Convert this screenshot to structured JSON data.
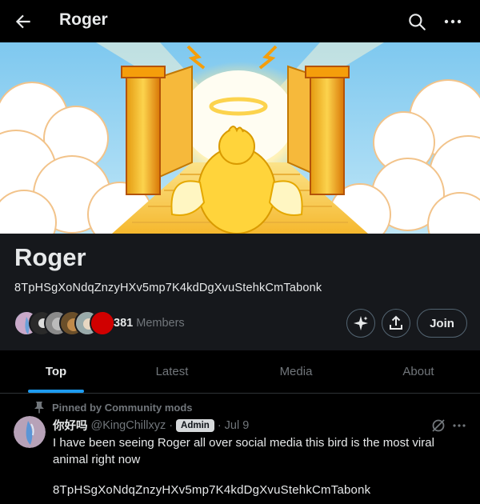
{
  "header": {
    "title": "Roger",
    "back_icon": "arrow-left-icon",
    "search_icon": "search-icon",
    "more_icon": "more-horizontal-icon"
  },
  "community": {
    "name": "Roger",
    "description": "8TpHSgXoNdqZnzyHXv5mp7K4kdDgXvuStehkCmTabonk",
    "member_count": "381",
    "members_label": "Members",
    "join_label": "Join"
  },
  "tabs": [
    {
      "label": "Top",
      "active": true
    },
    {
      "label": "Latest",
      "active": false
    },
    {
      "label": "Media",
      "active": false
    },
    {
      "label": "About",
      "active": false
    }
  ],
  "post": {
    "pinned_label": "Pinned by Community mods",
    "author_name": "你好吗",
    "author_handle": "@KingChillxyz",
    "badge": "Admin",
    "time": "Jul 9",
    "text": "I have been seeing Roger all over social media this bird is the most viral animal right now",
    "contract": "8TpHSgXoNdqZnzyHXv5mp7K4kdDgXvuStehkCmTabonk"
  },
  "colors": {
    "accent": "#1d9bf0",
    "background": "#000000",
    "panel": "#16181c",
    "muted_text": "#71767b"
  }
}
